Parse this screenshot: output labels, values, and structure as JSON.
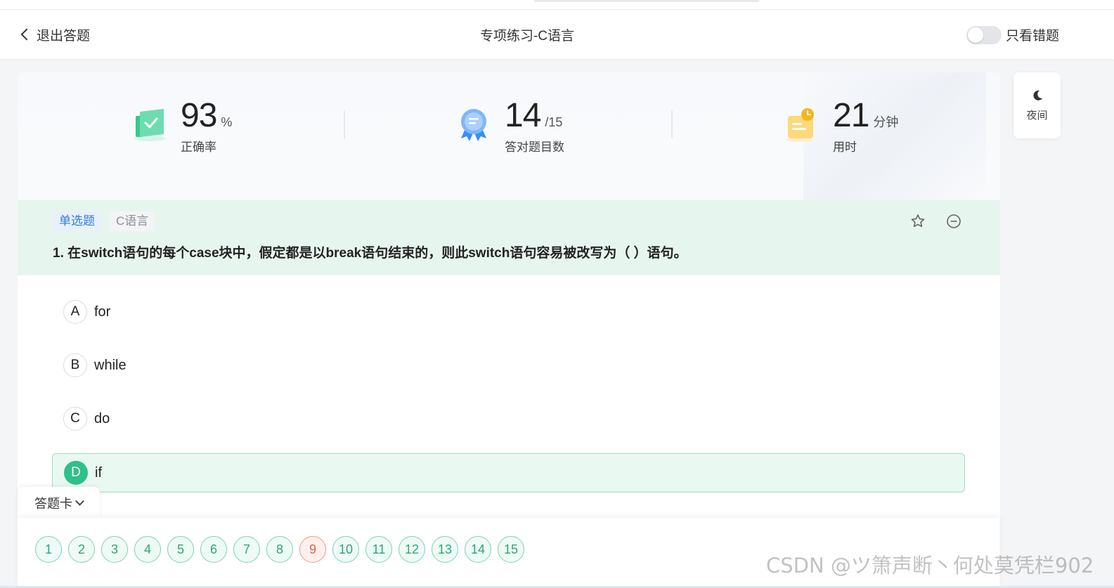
{
  "header": {
    "back_label": "退出答题",
    "title": "专项练习-C语言",
    "wrong_only_label": "只看错题",
    "wrong_only_on": false
  },
  "stats": {
    "accuracy": {
      "value": "93",
      "unit": "%",
      "label": "正确率"
    },
    "correct": {
      "value": "14",
      "unit": "/15",
      "label": "答对题目数"
    },
    "time": {
      "value": "21",
      "unit": "分钟",
      "label": "用时"
    }
  },
  "question": {
    "type_tag": "单选题",
    "subject_tag": "C语言",
    "text": "1. 在switch语句的每个case块中，假定都是以break语句结束的，则此switch语句容易被改写为（ ）语句。",
    "options": [
      {
        "letter": "A",
        "text": "for"
      },
      {
        "letter": "B",
        "text": "while"
      },
      {
        "letter": "C",
        "text": "do"
      },
      {
        "letter": "D",
        "text": "if"
      }
    ],
    "correct_option": "D"
  },
  "night_mode": {
    "label": "夜间"
  },
  "answer_card": {
    "label": "答题卡",
    "numbers": [
      "1",
      "2",
      "3",
      "4",
      "5",
      "6",
      "7",
      "8",
      "9",
      "10",
      "11",
      "12",
      "13",
      "14",
      "15"
    ],
    "wrong_number": "9"
  },
  "colors": {
    "accent_green": "#2ec08a",
    "wrong_red": "#e2603f",
    "tag_blue": "#2d7fd6"
  },
  "watermark": "CSDN @ツ箫声断丶何处莫凭栏902"
}
